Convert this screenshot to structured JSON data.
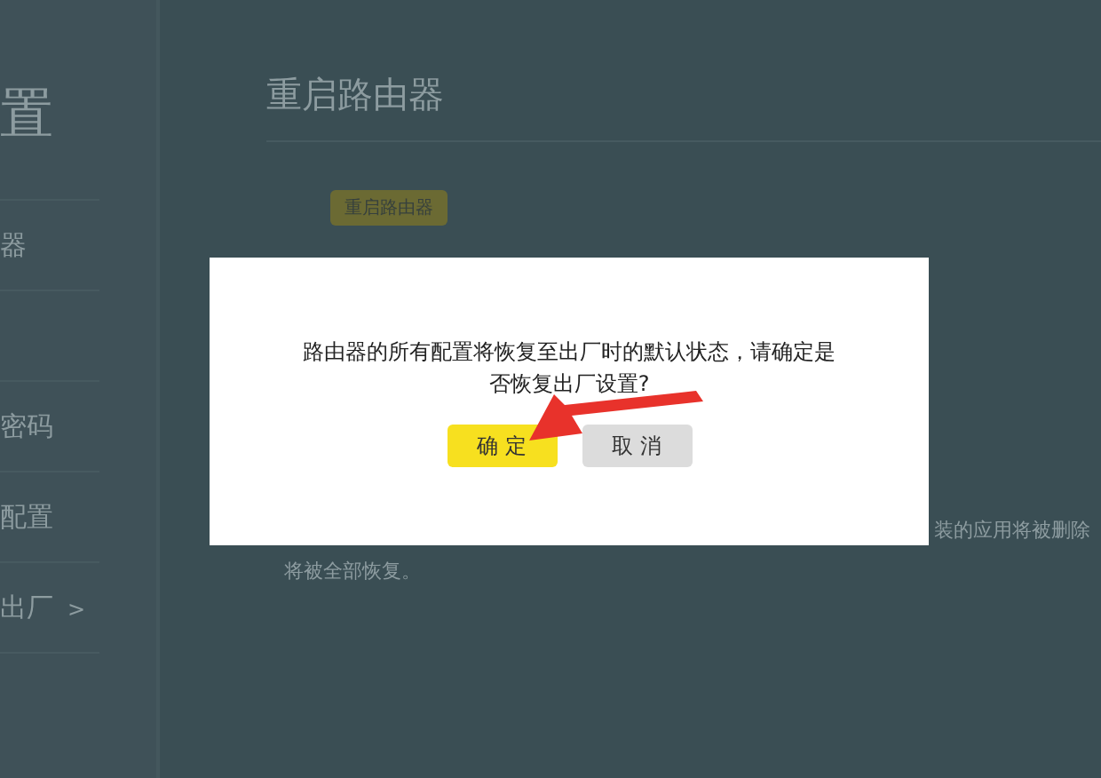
{
  "sidebar": {
    "title": "置",
    "items": [
      {
        "label": "器"
      },
      {
        "label": "密码"
      },
      {
        "label": "配置"
      },
      {
        "label": "出厂",
        "arrow": ">"
      }
    ]
  },
  "main": {
    "heading": "重启路由器",
    "button": "重启路由器",
    "note_left": "将被全部恢复。",
    "note_right": "装的应用将被删除"
  },
  "dialog": {
    "message": "路由器的所有配置将恢复至出厂时的默认状态，请确定是否恢复出厂设置?",
    "buttons": [
      {
        "label": "确 定",
        "kind": "primary"
      },
      {
        "label": "取 消",
        "kind": "secondary"
      }
    ]
  }
}
